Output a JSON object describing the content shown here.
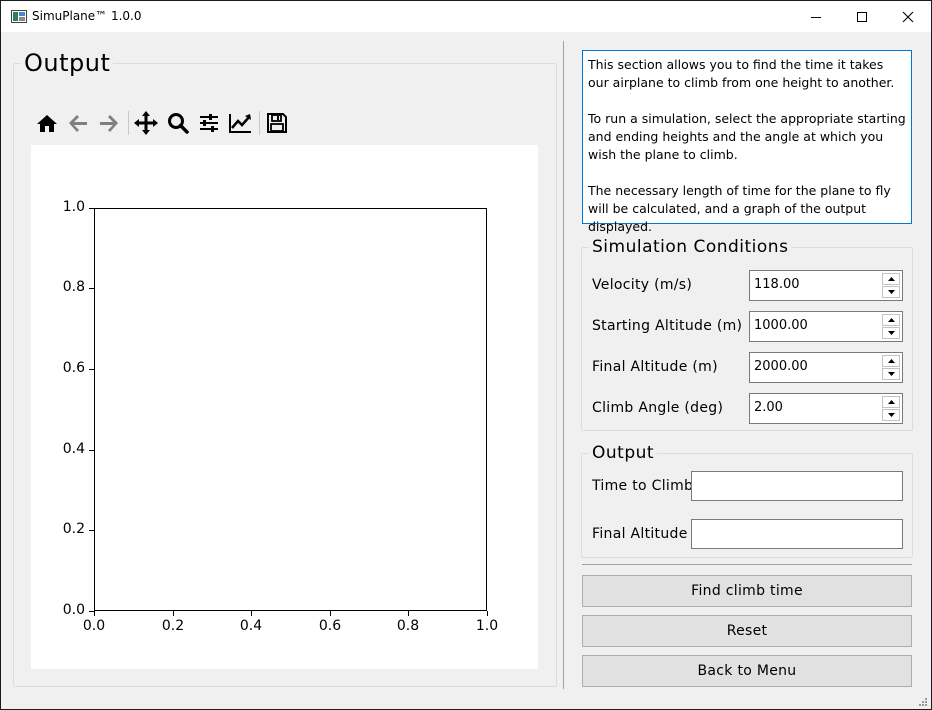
{
  "window": {
    "title": "SimuPlane™ 1.0.0",
    "icon": "app-plane-icon"
  },
  "left_panel": {
    "group_title": "Output",
    "toolbar": [
      "home-icon",
      "back-icon",
      "forward-icon",
      "pan-icon",
      "zoom-icon",
      "configure-subplots-icon",
      "edit-axis-icon",
      "save-icon"
    ]
  },
  "chart_data": {
    "type": "line",
    "series": [],
    "xlim": [
      0.0,
      1.0
    ],
    "ylim": [
      0.0,
      1.0
    ],
    "x_ticks": [
      "0.0",
      "0.2",
      "0.4",
      "0.6",
      "0.8",
      "1.0"
    ],
    "y_ticks": [
      "0.0",
      "0.2",
      "0.4",
      "0.6",
      "0.8",
      "1.0"
    ],
    "title": "",
    "xlabel": "",
    "ylabel": "",
    "grid": false
  },
  "right_panel": {
    "description": [
      "This section allows you to find the time it takes our airplane to climb from one height to another.",
      "To run a simulation, select the appropriate starting and ending heights and the angle at which you wish the plane to climb.",
      "The necessary length of time for the plane to fly will be calculated, and a graph of the output displayed."
    ],
    "conditions": {
      "title": "Simulation Conditions",
      "fields": [
        {
          "label": "Velocity (m/s)",
          "value": "118.00"
        },
        {
          "label": "Starting Altitude (m)",
          "value": "1000.00"
        },
        {
          "label": "Final Altitude (m)",
          "value": "2000.00"
        },
        {
          "label": "Climb Angle (deg)",
          "value": "2.00"
        }
      ]
    },
    "output": {
      "title": "Output",
      "fields": [
        {
          "label": "Time to Climb",
          "value": ""
        },
        {
          "label": "Final Altitude",
          "value": ""
        }
      ]
    },
    "buttons": {
      "find": "Find climb time",
      "reset": "Reset",
      "back": "Back to Menu"
    }
  }
}
